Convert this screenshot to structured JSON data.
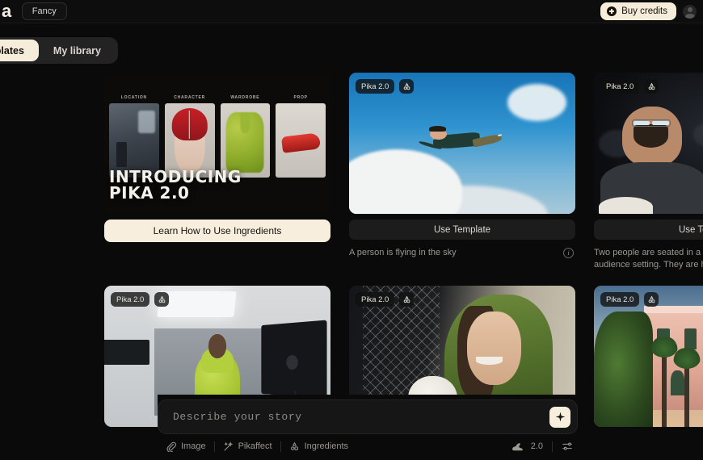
{
  "app": {
    "brand": "Pika",
    "brand_visible": "a",
    "mode_pill": "Fancy"
  },
  "topbar": {
    "buy_credits_label": "Buy credits",
    "plus_icon": "plus-circle-icon",
    "avatar_icon": "user-avatar-icon"
  },
  "tabs": [
    {
      "label": "Templates",
      "active": true
    },
    {
      "label": "My library",
      "active": false
    }
  ],
  "cards": [
    {
      "type": "promo",
      "title_line1": "INTRODUCING",
      "title_line2": "PIKA 2.0",
      "thumb_labels": [
        "LOCATION",
        "CHARACTER",
        "WARDROBE",
        "PROP"
      ],
      "cta_label": "Learn How to Use Ingredients"
    },
    {
      "type": "template",
      "badge_model": "Pika 2.0",
      "badge_icon": "ingredients-icon",
      "cta_label": "Use Template",
      "caption": "A person is flying in the sky",
      "info_icon": "info-icon",
      "scene": "man-flying-above-clouds"
    },
    {
      "type": "template",
      "badge_model": "Pika 2.0",
      "badge_icon": "ingredients-icon",
      "cta_label": "Use Template",
      "caption": "Two people are seated in a darkened theater or audience setting. They are holding a tub of popcorn,",
      "scene": "couple-in-movie-theater"
    },
    {
      "type": "template",
      "badge_model": "Pika 2.0",
      "badge_icon": "ingredients-icon",
      "scene": "photo-studio-green-jacket"
    },
    {
      "type": "template",
      "badge_model": "Pika 2.0",
      "badge_icon": "ingredients-icon",
      "scene": "girl-green-hood-with-cat"
    },
    {
      "type": "template",
      "badge_model": "Pika 2.0",
      "badge_icon": "ingredients-icon",
      "scene": "pink-villa-man-palm-trees"
    }
  ],
  "prompt": {
    "placeholder": "Describe your story",
    "value": "",
    "send_icon": "sparkle-icon",
    "tools": [
      {
        "label": "Image",
        "icon": "paperclip-icon"
      },
      {
        "label": "Pikaffect",
        "icon": "magic-wand-icon"
      },
      {
        "label": "Ingredients",
        "icon": "ingredients-icon"
      }
    ],
    "version": "2.0",
    "version_icon": "pika-rabbit-icon",
    "settings_icon": "sliders-icon"
  },
  "colors": {
    "background": "#0a0a0a",
    "accent_cream": "#f5ecd9",
    "surface": "#1c1c1c",
    "text_muted": "#9b9892"
  }
}
